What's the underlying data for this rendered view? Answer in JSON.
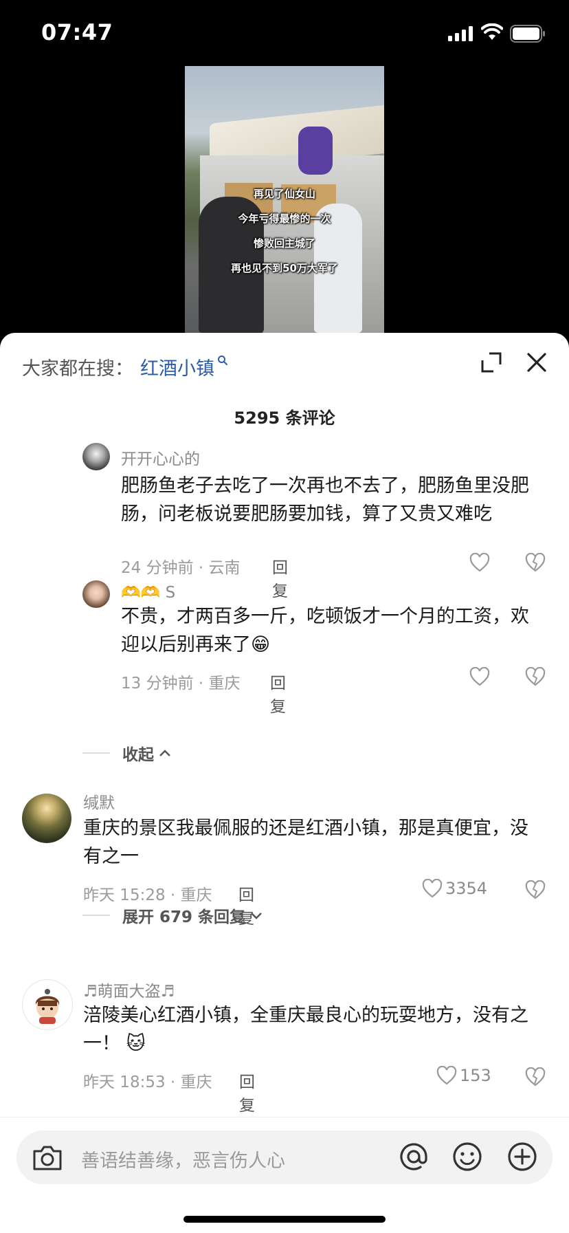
{
  "status": {
    "time": "07:47"
  },
  "video": {
    "captions": [
      "再见了仙女山",
      "今年亏得最惨的一次",
      "惨败回主城了",
      "再也见不到50万大军了"
    ]
  },
  "search": {
    "prefix": "大家都在搜：",
    "keyword": "红酒小镇"
  },
  "count": "5295 条评论",
  "comments": [
    {
      "name": "开开心心的",
      "text": "肥肠鱼老子去吃了一次再也不去了，肥肠鱼里没肥肠，问老板说要肥肠要加钱，算了又贵又难吃",
      "meta": "24 分钟前 · 云南",
      "reply": "回复",
      "likes": ""
    },
    {
      "name": "🫶🫶 S",
      "text": "不贵，才两百多一斤，吃顿饭才一个月的工资，欢迎以后别再来了😁",
      "meta": "13 分钟前 · 重庆",
      "reply": "回复",
      "likes": ""
    },
    {
      "name": "缄默",
      "text": "重庆的景区我最佩服的还是红酒小镇，那是真便宜，没有之一",
      "meta": "昨天 15:28 · 重庆",
      "reply": "回复",
      "likes": "3354"
    },
    {
      "name": "♬萌面大盗♬",
      "text": "涪陵美心红酒小镇，全重庆最良心的玩耍地方，没有之一！ 🐱",
      "meta": "昨天 18:53 · 重庆",
      "reply": "回复",
      "likes": "153"
    }
  ],
  "collapse": "收起",
  "expand": "展开 679 条回复",
  "input_placeholder": "善语结善缘，恶言伤人心"
}
